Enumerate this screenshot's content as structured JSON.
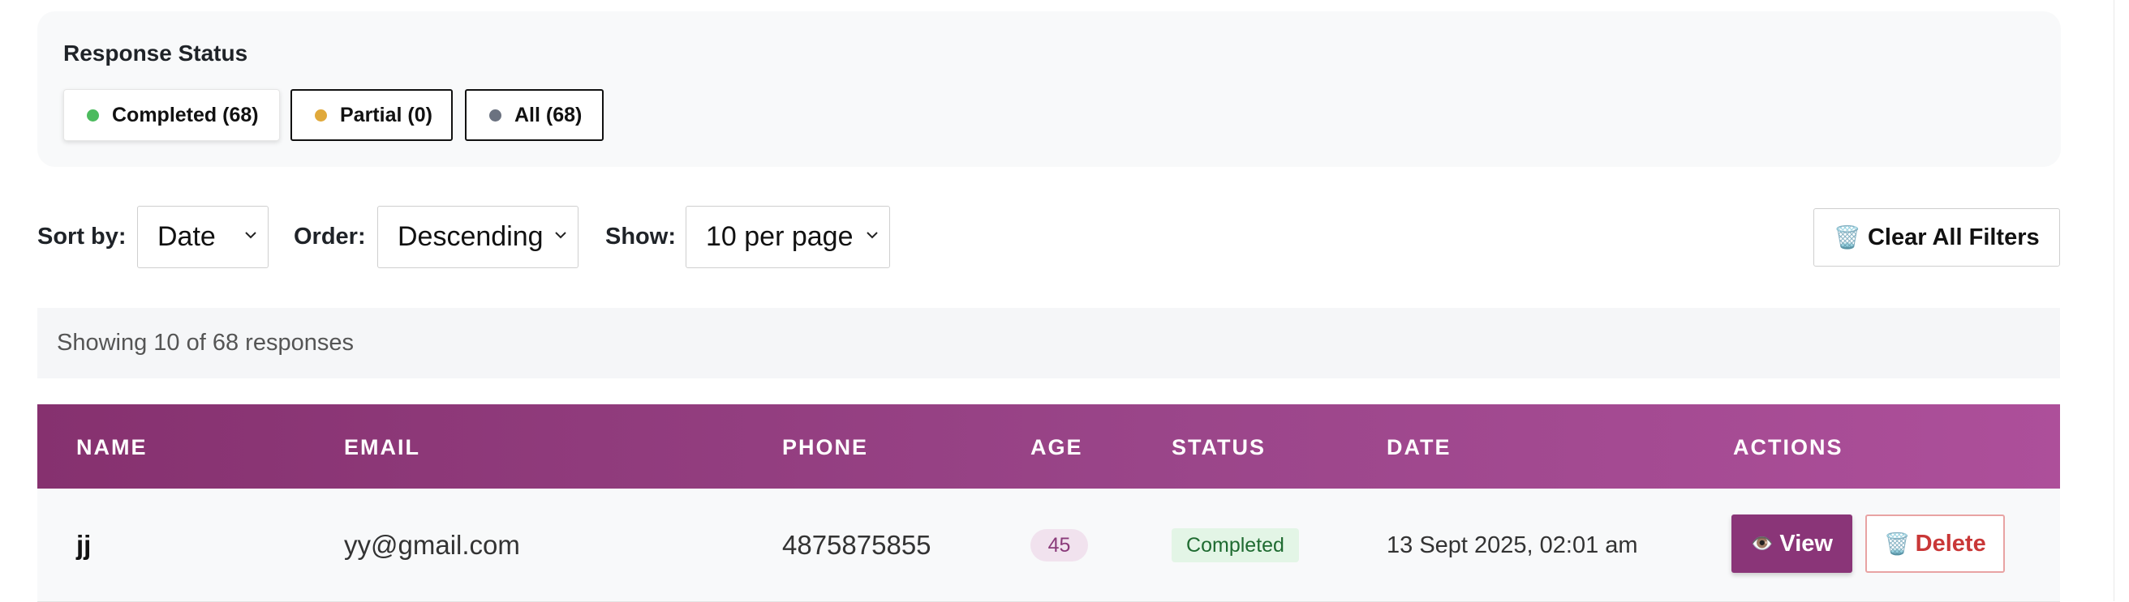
{
  "response_status": {
    "title": "Response Status",
    "chips": [
      {
        "label": "Completed (68)",
        "dot_color": "#4cbb5e"
      },
      {
        "label": "Partial (0)",
        "dot_color": "#e0a93b"
      },
      {
        "label": "All (68)",
        "dot_color": "#6b7280"
      }
    ]
  },
  "controls": {
    "sort_label": "Sort by:",
    "sort_value": "Date",
    "order_label": "Order:",
    "order_value": "Descending",
    "show_label": "Show:",
    "show_value": "10 per page",
    "clear_label": "Clear All Filters",
    "clear_icon": "trash-icon"
  },
  "showing_text": "Showing 10 of 68 responses",
  "table": {
    "headers": [
      "NAME",
      "EMAIL",
      "PHONE",
      "AGE",
      "STATUS",
      "DATE",
      "ACTIONS"
    ],
    "header_gradient": [
      "#86316f",
      "#ad4f9a"
    ],
    "rows": [
      {
        "name": "jj",
        "email": "yy@gmail.com",
        "phone": "4875875855",
        "age": "45",
        "status": "Completed",
        "date": "13 Sept 2025, 02:01 am",
        "view_label": "View",
        "view_icon": "eye-icon",
        "delete_label": "Delete",
        "delete_icon": "trash-icon"
      }
    ]
  },
  "colors": {
    "accent": "#8a3578",
    "delete_text": "#c93737",
    "completed_badge_bg": "#e3f5e6"
  }
}
